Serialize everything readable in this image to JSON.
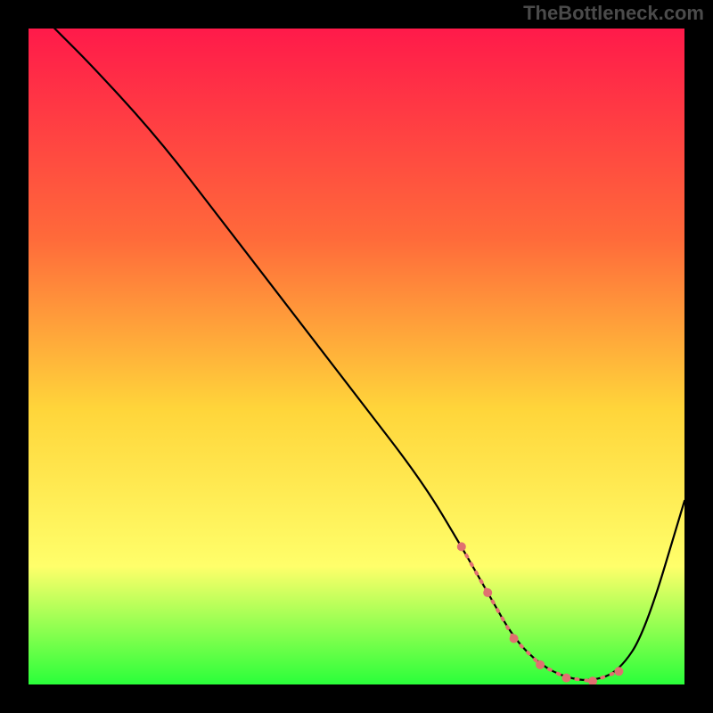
{
  "watermark": "TheBottleneck.com",
  "chart_data": {
    "type": "line",
    "title": "",
    "xlabel": "",
    "ylabel": "",
    "xlim": [
      0,
      100
    ],
    "ylim": [
      0,
      100
    ],
    "series": [
      {
        "name": "curve",
        "x": [
          0,
          4,
          10,
          20,
          30,
          40,
          50,
          60,
          66,
          70,
          74,
          78,
          82,
          86,
          90,
          94,
          100
        ],
        "values": [
          104,
          100,
          94,
          83,
          70,
          57,
          44,
          31,
          21,
          14,
          7,
          3,
          1,
          0.5,
          2,
          8,
          28
        ]
      },
      {
        "name": "highlight-band",
        "x": [
          66,
          70,
          74,
          78,
          82,
          86,
          90
        ],
        "values": [
          21,
          14,
          7,
          3,
          1,
          0.5,
          2
        ]
      }
    ],
    "colors": {
      "curve": "#000000",
      "highlight": "#e07070",
      "gradient_top": "#ff1a4a",
      "gradient_mid1": "#ff6a3a",
      "gradient_mid2": "#ffd53a",
      "gradient_mid3": "#ffff6a",
      "gradient_bottom": "#2aff3a"
    }
  }
}
